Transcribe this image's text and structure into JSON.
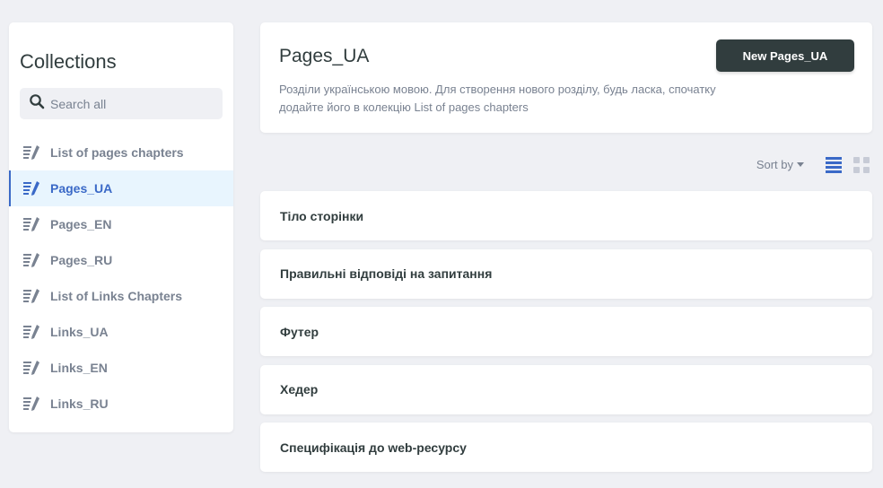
{
  "sidebar": {
    "title": "Collections",
    "search_placeholder": "Search all",
    "items": [
      {
        "label": "List of pages chapters",
        "active": false
      },
      {
        "label": "Pages_UA",
        "active": true
      },
      {
        "label": "Pages_EN",
        "active": false
      },
      {
        "label": "Pages_RU",
        "active": false
      },
      {
        "label": "List of Links Chapters",
        "active": false
      },
      {
        "label": "Links_UA",
        "active": false
      },
      {
        "label": "Links_EN",
        "active": false
      },
      {
        "label": "Links_RU",
        "active": false
      }
    ]
  },
  "header": {
    "title": "Pages_UA",
    "description": "Розділи українською мовою. Для створення нового розділу, будь ласка, спочатку додайте його в колекцію List of pages chapters",
    "new_button_label": "New Pages_UA"
  },
  "toolbar": {
    "sort_label": "Sort by",
    "list_view_icon": "list-view-icon",
    "grid_view_icon": "grid-view-icon",
    "active_view": "list"
  },
  "entries": [
    {
      "title": "Тіло сторінки"
    },
    {
      "title": "Правильні відповіді на запитання"
    },
    {
      "title": "Футер"
    },
    {
      "title": "Хедер"
    },
    {
      "title": "Специфікація до web-ресурсу"
    }
  ],
  "colors": {
    "background": "#eff0f4",
    "accent": "#3a69c7",
    "active_bg": "#e8f5fe",
    "button_dark": "#313d3e",
    "muted_text": "#798291"
  }
}
